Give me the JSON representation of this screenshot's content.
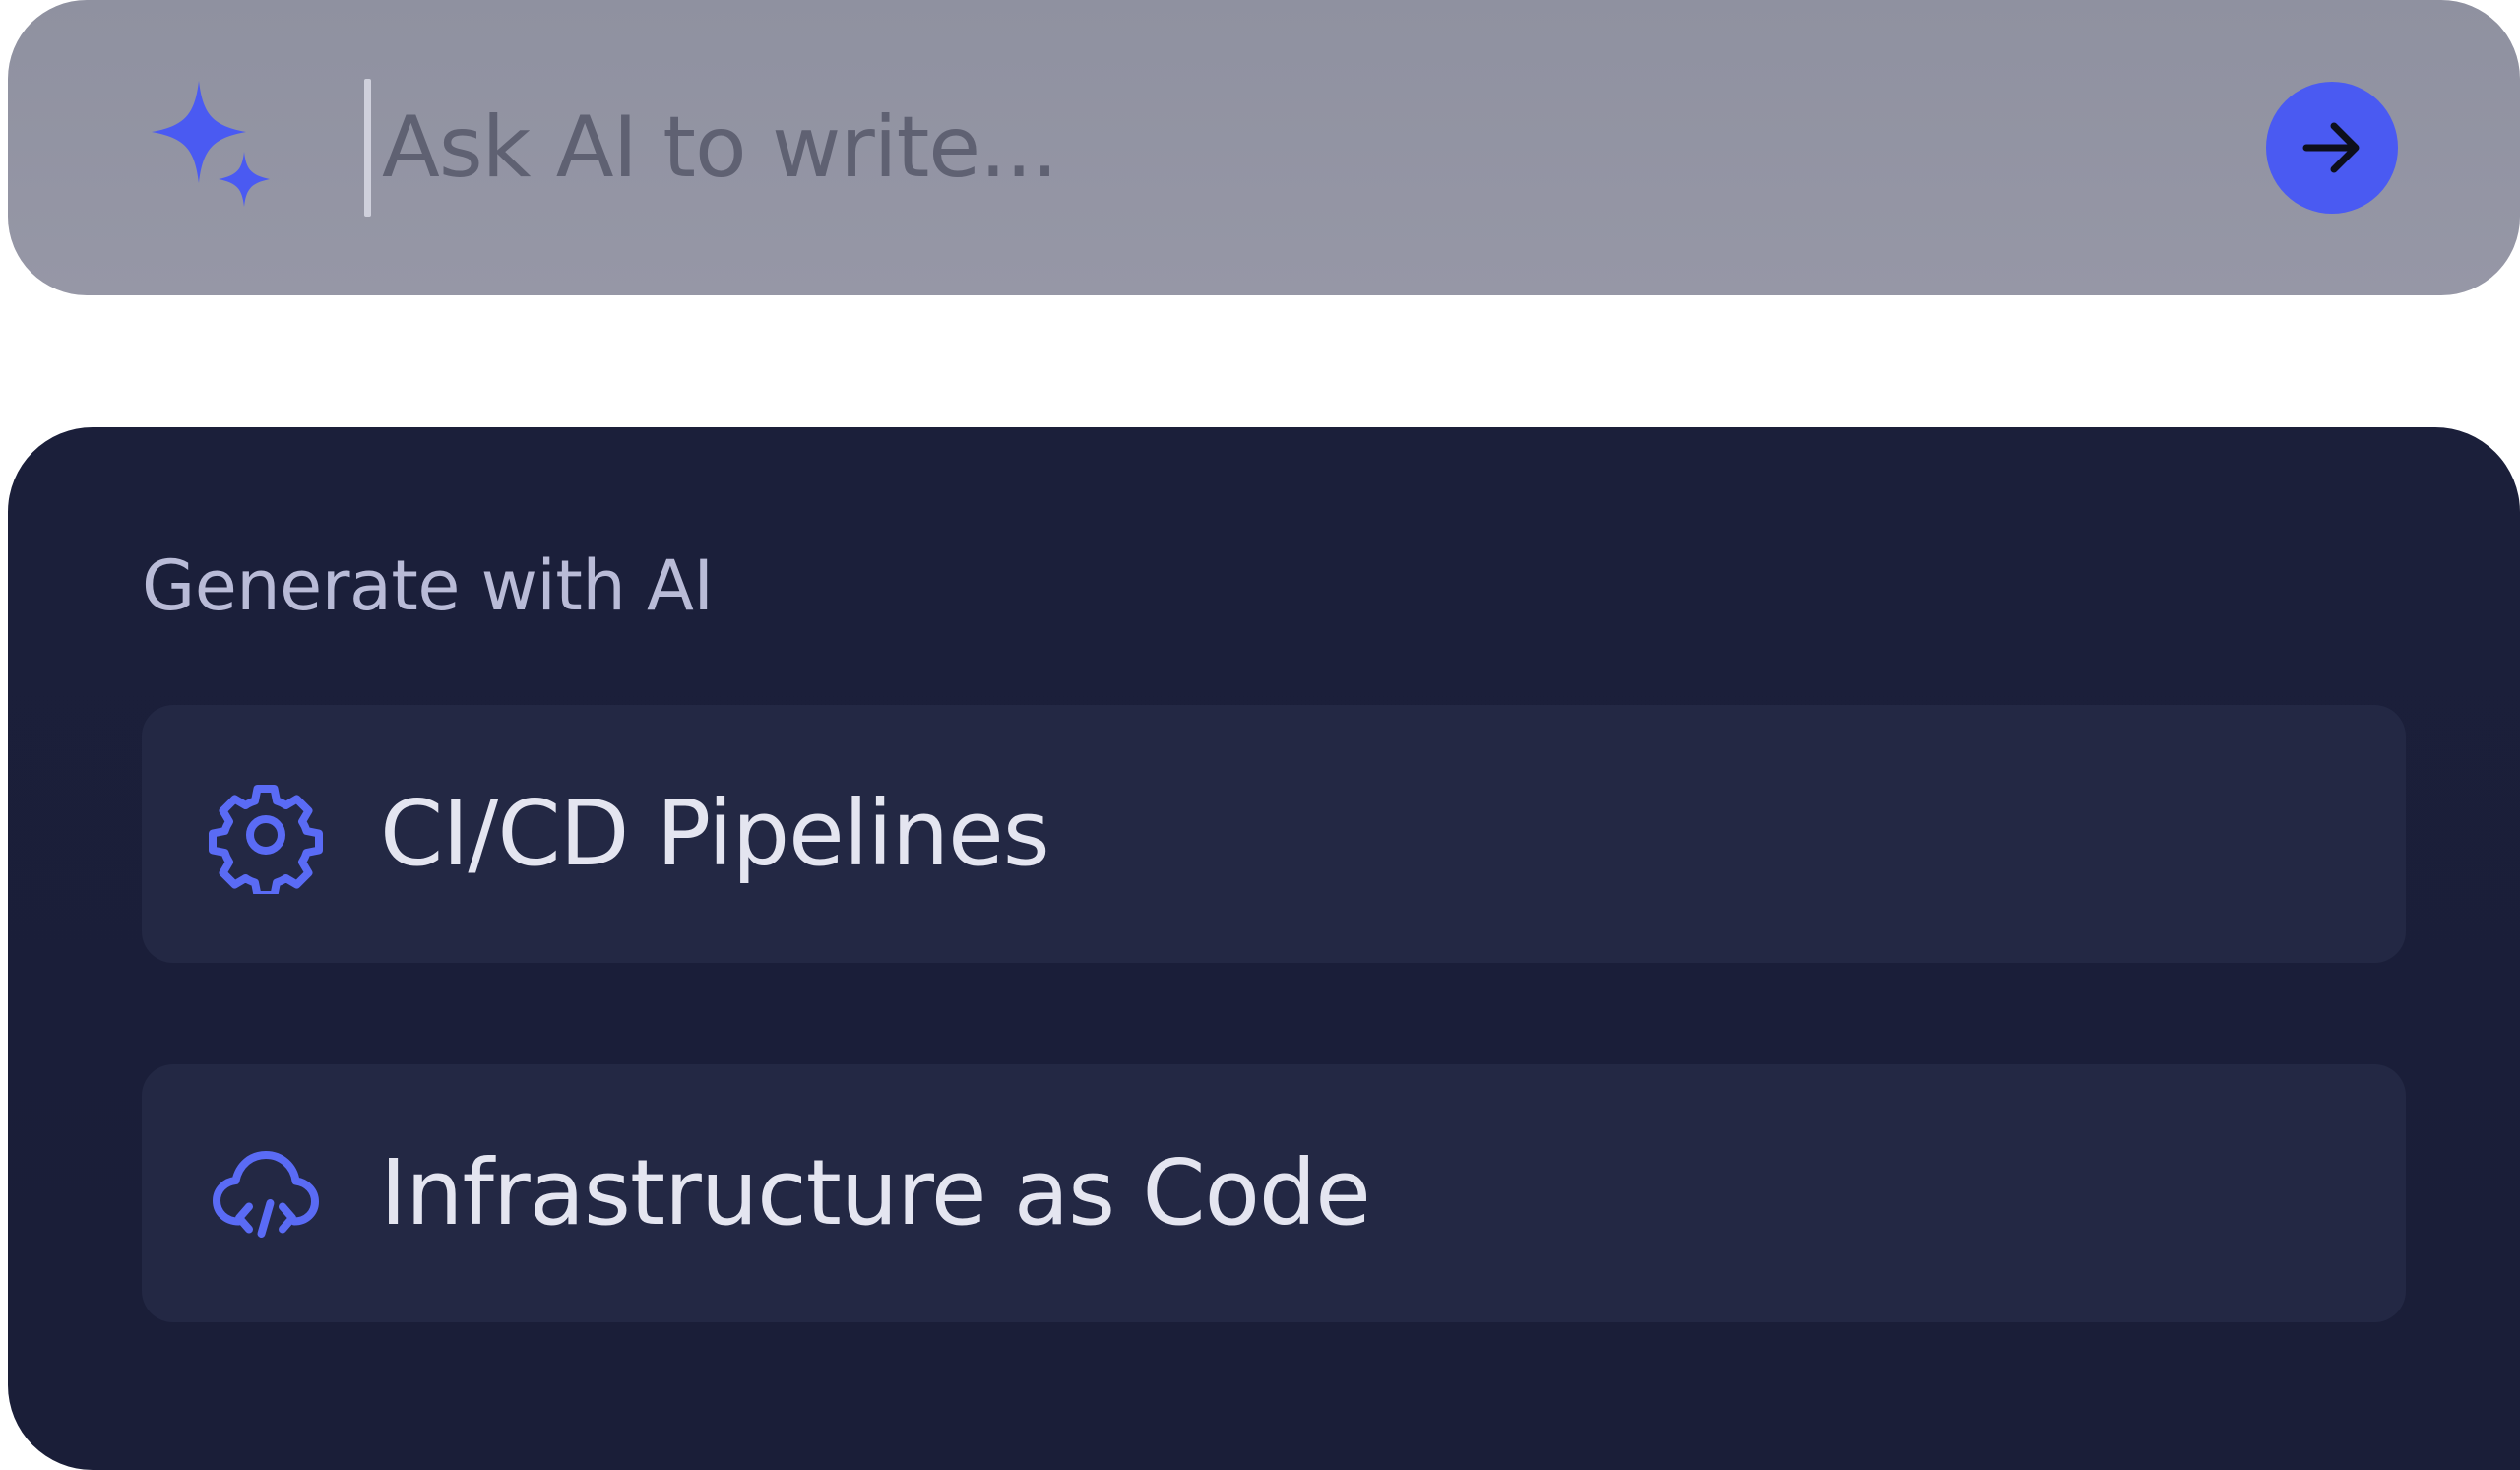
{
  "prompt": {
    "placeholder": "Ask AI to write...",
    "leading_icon": "sparkle-icon",
    "send_icon": "arrow-right-icon"
  },
  "generate_panel": {
    "title": "Generate with AI",
    "options": [
      {
        "label": "CI/CD Pipelines",
        "icon": "gear-icon"
      },
      {
        "label": "Infrastructure as Code",
        "icon": "cloud-code-icon"
      }
    ]
  },
  "colors": {
    "accent": "#4a5af2",
    "prompt_bar_bg": "#9395a4",
    "panel_bg": "#1b1f3a",
    "option_bg": "#232844",
    "option_text": "#e4e5f0",
    "panel_title_text": "#b9bbd7"
  }
}
